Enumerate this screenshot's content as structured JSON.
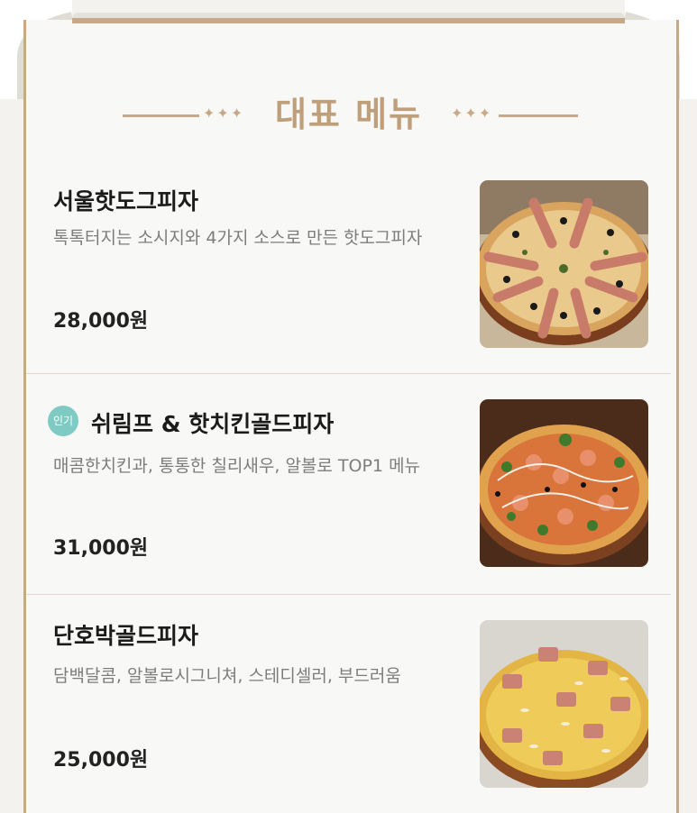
{
  "header": {
    "title": "대표 메뉴",
    "left_ornament": "✦✦✦",
    "right_ornament": "✦✦✦"
  },
  "menu": {
    "items": [
      {
        "name": "서울핫도그피자",
        "badge": "",
        "description": "톡톡터지는 소시지와 4가지 소스로 만든 핫도그피자",
        "price": "28,000원",
        "image": "pizza-hotdog-photo"
      },
      {
        "name": "쉬림프 & 핫치킨골드피자",
        "badge": "인기",
        "description": "매콤한치킨과, 통통한 칠리새우, 알볼로 TOP1 메뉴",
        "price": "31,000원",
        "image": "pizza-shrimp-chicken-photo"
      },
      {
        "name": "단호박골드피자",
        "badge": "",
        "description": "담백달콤, 알볼로시그니쳐, 스테디셀러, 부드러움",
        "price": "25,000원",
        "image": "pizza-pumpkin-photo"
      }
    ]
  },
  "colors": {
    "accent": "#c7a989",
    "heading": "#bf9f7a",
    "badge": "#7fcbc4",
    "price": "#222222",
    "description": "#7d7d7d"
  }
}
